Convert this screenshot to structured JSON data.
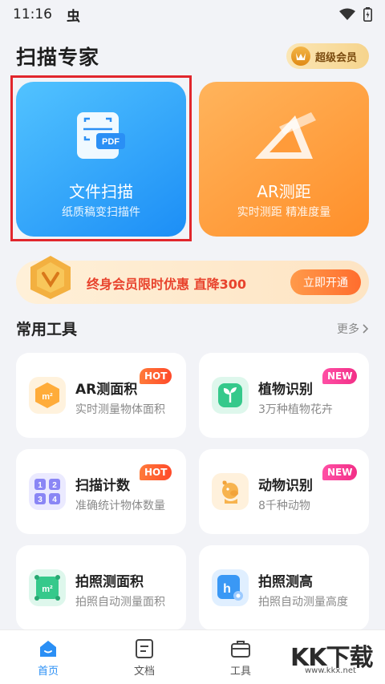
{
  "status_bar": {
    "time": "11:16",
    "notif_char": "虫"
  },
  "header": {
    "title": "扫描专家",
    "vip_label": "超级会员"
  },
  "main_cards": [
    {
      "title": "文件扫描",
      "subtitle": "纸质稿变扫描件",
      "icon": "scan-pdf-icon",
      "icon_text": "PDF"
    },
    {
      "title": "AR测距",
      "subtitle": "实时测距 精准度量",
      "icon": "ruler-triangle-icon"
    }
  ],
  "promo": {
    "text": "终身会员限时优惠 直降300",
    "button": "立即开通"
  },
  "tools_section": {
    "title": "常用工具",
    "more": "更多"
  },
  "tools": [
    {
      "name": "AR测面积",
      "desc": "实时测量物体面积",
      "tag": "HOT",
      "icon": "area-cube-icon",
      "icon_text": "m²"
    },
    {
      "name": "植物识别",
      "desc": "3万种植物花卉",
      "tag": "NEW",
      "icon": "plant-icon"
    },
    {
      "name": "扫描计数",
      "desc": "准确统计物体数量",
      "tag": "HOT",
      "icon": "count-grid-icon",
      "icon_digits": [
        "1",
        "2",
        "3",
        "4"
      ]
    },
    {
      "name": "动物识别",
      "desc": "8千种动物",
      "tag": "NEW",
      "icon": "dog-icon"
    },
    {
      "name": "拍照测面积",
      "desc": "拍照自动测量面积",
      "icon": "photo-area-icon",
      "icon_text": "m²"
    },
    {
      "name": "拍照测高",
      "desc": "拍照自动测量高度",
      "icon": "photo-height-icon",
      "icon_text": "h"
    }
  ],
  "bottom_nav": [
    {
      "label": "首页",
      "icon": "home-icon",
      "active": true
    },
    {
      "label": "文档",
      "icon": "document-icon",
      "active": false
    },
    {
      "label": "工具",
      "icon": "toolbox-icon",
      "active": false
    }
  ],
  "watermark": {
    "text": "KK下载",
    "url": "www.kkx.net"
  },
  "colors": {
    "accent_blue": "#2a8ff5",
    "accent_orange": "#ff8f2a",
    "highlight_red": "#e1262c"
  }
}
